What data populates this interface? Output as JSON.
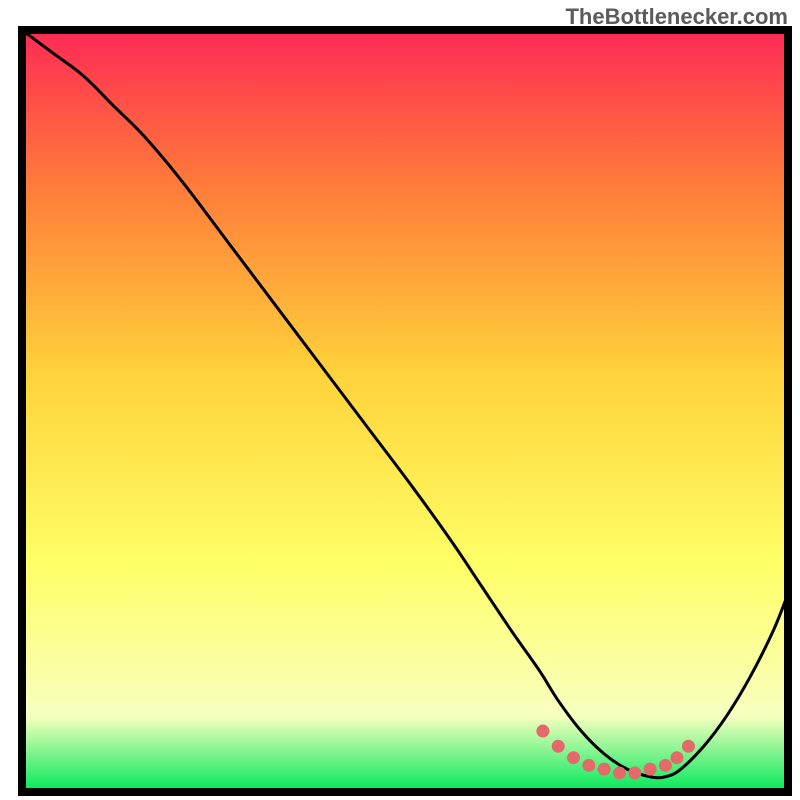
{
  "watermark": {
    "text": "TheBottlenecker.com"
  },
  "colors": {
    "gradient_top": "#ff2a55",
    "gradient_mid1": "#ff7a3a",
    "gradient_mid2": "#ffd23a",
    "gradient_mid3": "#ffff66",
    "gradient_pale": "#f7ffbf",
    "gradient_bottom": "#00e85a",
    "frame": "#000000",
    "curve": "#000000",
    "markers": "#e46a6a"
  },
  "chart_data": {
    "type": "line",
    "title": "",
    "xlabel": "",
    "ylabel": "",
    "xlim": [
      0,
      100
    ],
    "ylim": [
      0,
      100
    ],
    "grid": false,
    "legend": null,
    "annotations": [],
    "series": [
      {
        "name": "bottleneck-curve",
        "x": [
          0,
          4,
          8,
          12,
          16,
          21,
          27,
          33,
          39,
          45,
          51,
          56,
          60,
          64,
          67.5,
          70,
          73,
          76,
          79,
          82,
          84,
          86,
          89,
          92,
          95,
          98,
          100
        ],
        "y": [
          100,
          97,
          94,
          90,
          86,
          80,
          72,
          64,
          56,
          48,
          40,
          33,
          27,
          21,
          16,
          12,
          8,
          5,
          3,
          2,
          2,
          3,
          6,
          10,
          15,
          21,
          26
        ]
      }
    ],
    "markers": {
      "name": "optimal-range-dots",
      "x": [
        68,
        70,
        72,
        74,
        76,
        78,
        80,
        82,
        84,
        85.5,
        87
      ],
      "y": [
        8,
        6,
        4.5,
        3.5,
        3,
        2.5,
        2.5,
        3,
        3.5,
        4.5,
        6
      ]
    },
    "gradient_bands": [
      {
        "y_from": 100,
        "y_to": 80,
        "from_color": "#ff2a55",
        "to_color": "#ff7a3a"
      },
      {
        "y_from": 80,
        "y_to": 55,
        "from_color": "#ff7a3a",
        "to_color": "#ffd23a"
      },
      {
        "y_from": 55,
        "y_to": 30,
        "from_color": "#ffd23a",
        "to_color": "#ffff66"
      },
      {
        "y_from": 30,
        "y_to": 10,
        "from_color": "#ffff66",
        "to_color": "#f7ffbf"
      },
      {
        "y_from": 10,
        "y_to": 0,
        "from_color": "#f7ffbf",
        "to_color": "#00e85a"
      }
    ]
  }
}
